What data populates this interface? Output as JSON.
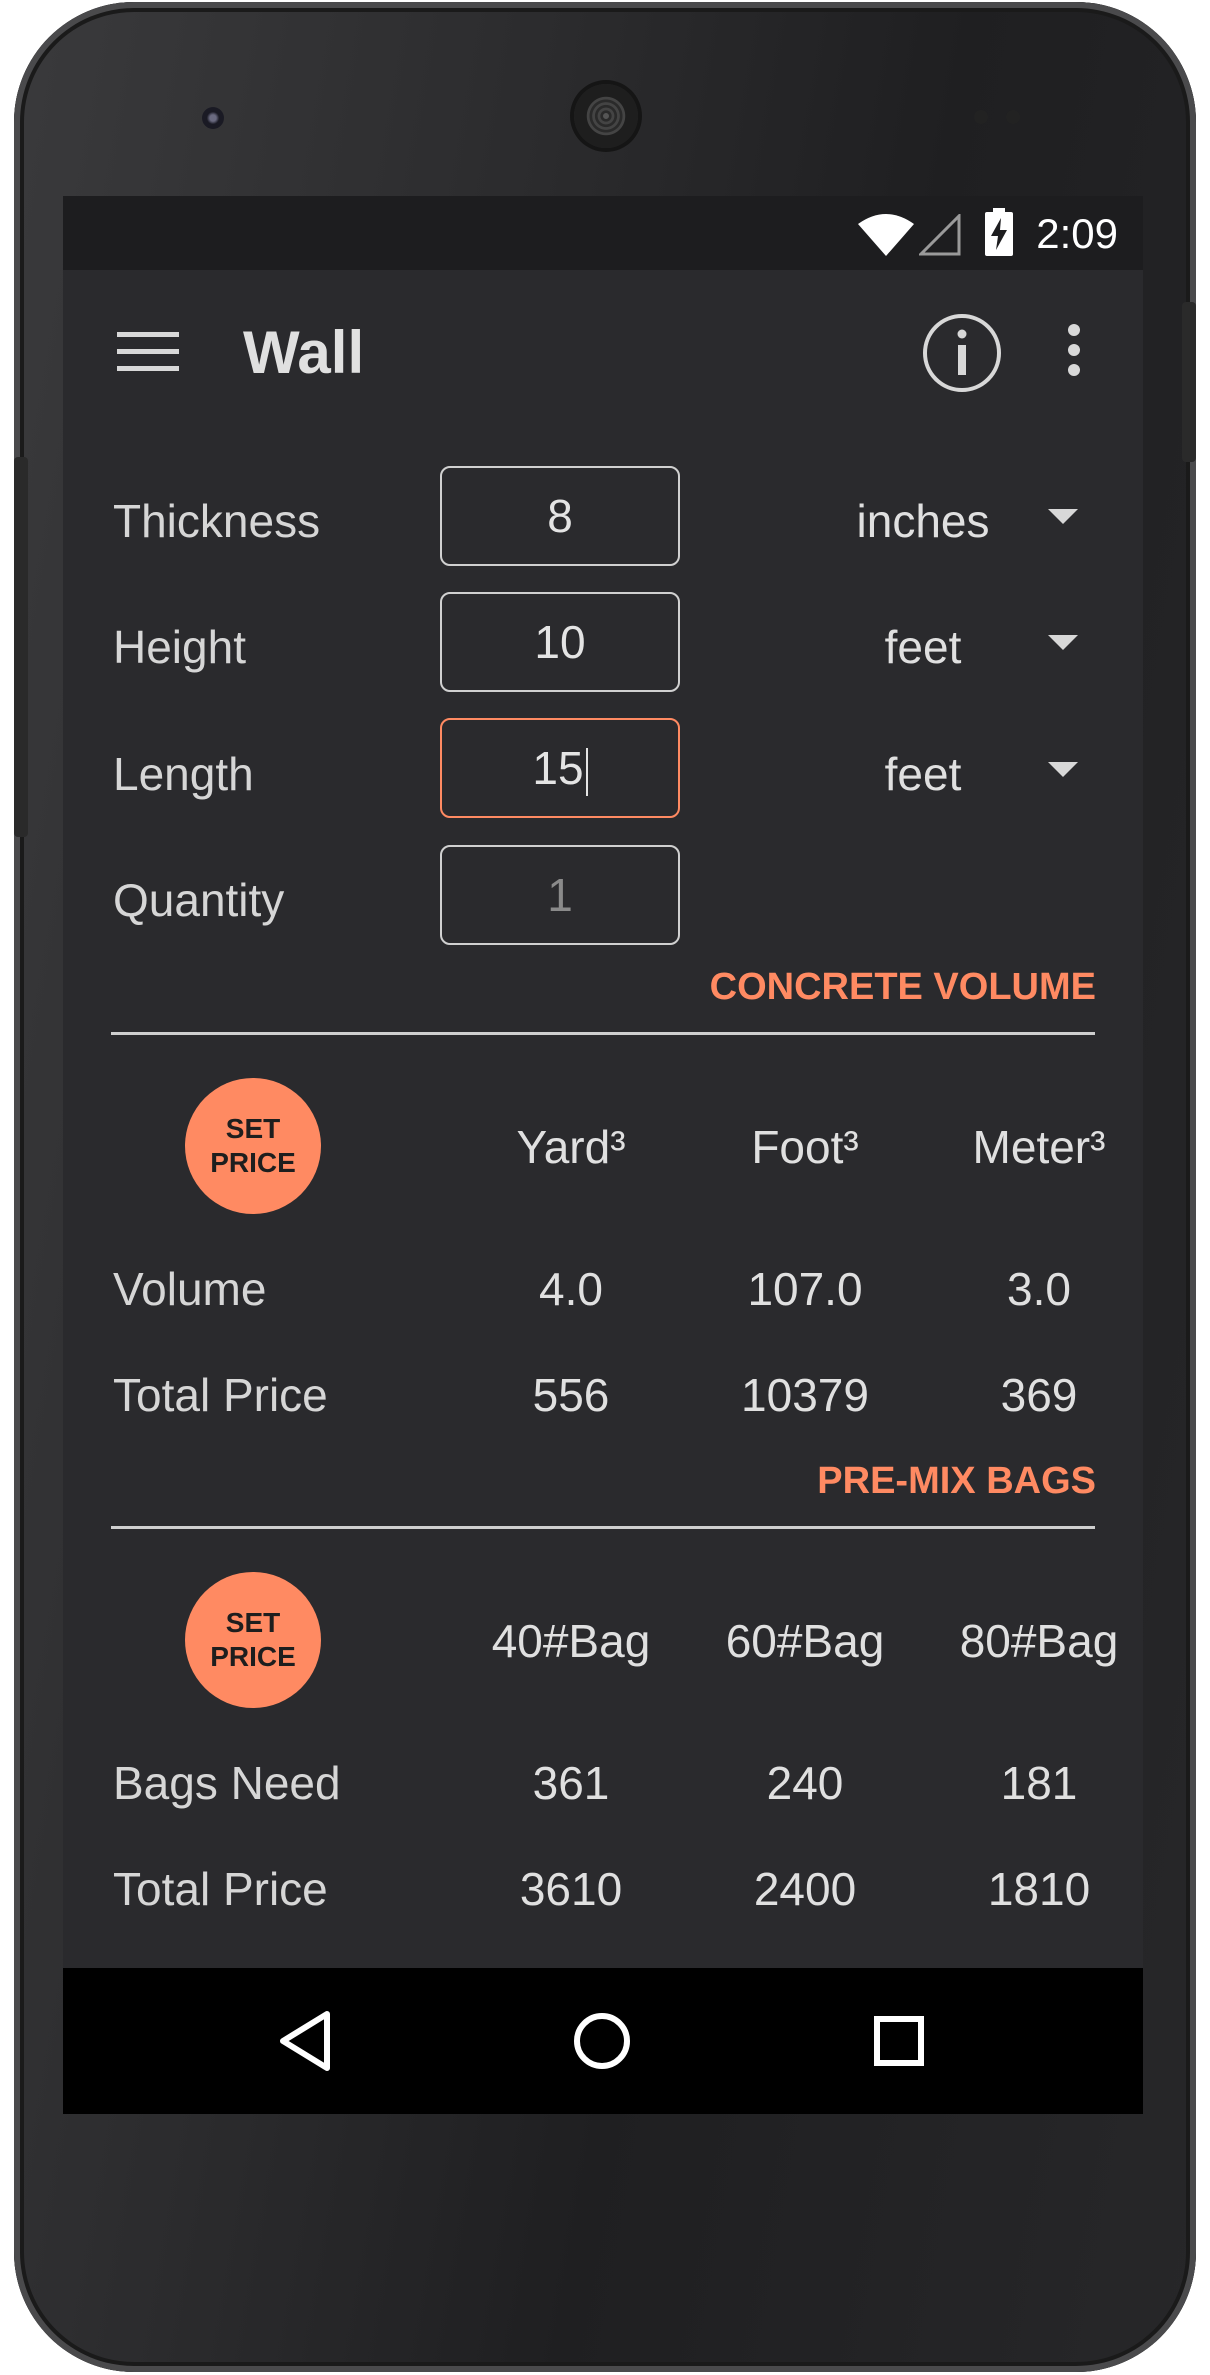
{
  "status_bar": {
    "time": "2:09"
  },
  "app_bar": {
    "title": "Wall"
  },
  "inputs": [
    {
      "label": "Thickness",
      "value": "8",
      "unit": "inches",
      "has_unit": true,
      "state": "normal"
    },
    {
      "label": "Height",
      "value": "10",
      "unit": "feet",
      "has_unit": true,
      "state": "normal"
    },
    {
      "label": "Length",
      "value": "15",
      "unit": "feet",
      "has_unit": true,
      "state": "focused"
    },
    {
      "label": "Quantity",
      "value": "",
      "placeholder": "1",
      "has_unit": false,
      "state": "placeholder"
    }
  ],
  "concrete_volume": {
    "title": "CONCRETE VOLUME",
    "set_price_line1": "SET",
    "set_price_line2": "PRICE",
    "columns": [
      "Yard³",
      "Foot³",
      "Meter³"
    ],
    "rows": [
      {
        "label": "Volume",
        "values": [
          "4.0",
          "107.0",
          "3.0"
        ]
      },
      {
        "label": "Total Price",
        "values": [
          "556",
          "10379",
          "369"
        ]
      }
    ]
  },
  "premix_bags": {
    "title": "PRE-MIX BAGS",
    "set_price_line1": "SET",
    "set_price_line2": "PRICE",
    "columns": [
      "40#Bag",
      "60#Bag",
      "80#Bag"
    ],
    "rows": [
      {
        "label": "Bags Need",
        "values": [
          "361",
          "240",
          "181"
        ]
      },
      {
        "label": "Total Price",
        "values": [
          "3610",
          "2400",
          "1810"
        ]
      }
    ]
  },
  "colors": {
    "accent": "#ff8a62",
    "screen_bg": "#2a2a2d",
    "status_bar_bg": "#1d1d1f",
    "nav_bar_bg": "#000000"
  },
  "icons": {
    "menu": "hamburger-menu-icon",
    "info": "info-icon",
    "overflow": "more-vert-icon",
    "wifi": "wifi-icon",
    "cell": "cell-signal-icon",
    "battery": "battery-charging-icon",
    "back": "back-icon",
    "home": "home-icon",
    "recents": "recents-icon"
  }
}
